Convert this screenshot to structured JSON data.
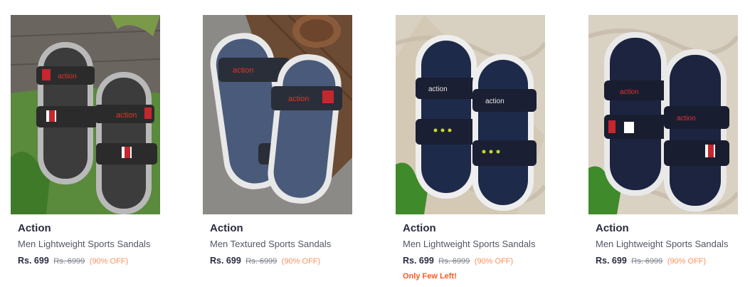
{
  "products": [
    {
      "brand": "Action",
      "name": "Men Lightweight Sports Sandals",
      "price": "Rs. 699",
      "mrp": "Rs. 6999",
      "discount": "(90% OFF)",
      "stock_note": ""
    },
    {
      "brand": "Action",
      "name": "Men Textured Sports Sandals",
      "price": "Rs. 699",
      "mrp": "Rs. 6999",
      "discount": "(90% OFF)",
      "stock_note": ""
    },
    {
      "brand": "Action",
      "name": "Men Lightweight Sports Sandals",
      "price": "Rs. 699",
      "mrp": "Rs. 6999",
      "discount": "(90% OFF)",
      "stock_note": "Only Few Left!"
    },
    {
      "brand": "Action",
      "name": "Men Lightweight Sports Sandals",
      "price": "Rs. 699",
      "mrp": "Rs. 6999",
      "discount": "(90% OFF)",
      "stock_note": ""
    }
  ],
  "image_logo_text": "action",
  "colors": {
    "brand_text": "#282c3f",
    "name_text": "#535766",
    "mrp_text": "#7e818c",
    "discount_text": "#ff905a",
    "stock_text": "#ff5722"
  }
}
